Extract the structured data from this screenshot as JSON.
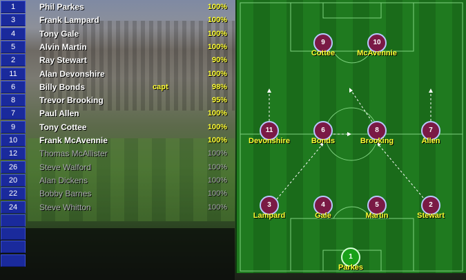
{
  "squad": [
    {
      "number": "1",
      "name": "Phil Parkes",
      "role": "",
      "fitness": "100%",
      "starter": true
    },
    {
      "number": "3",
      "name": "Frank Lampard",
      "role": "",
      "fitness": "100%",
      "starter": true
    },
    {
      "number": "4",
      "name": "Tony Gale",
      "role": "",
      "fitness": "100%",
      "starter": true
    },
    {
      "number": "5",
      "name": "Alvin Martin",
      "role": "",
      "fitness": "100%",
      "starter": true
    },
    {
      "number": "2",
      "name": "Ray Stewart",
      "role": "",
      "fitness": "90%",
      "starter": true
    },
    {
      "number": "11",
      "name": "Alan Devonshire",
      "role": "",
      "fitness": "100%",
      "starter": true
    },
    {
      "number": "6",
      "name": "Billy Bonds",
      "role": "capt",
      "fitness": "98%",
      "starter": true
    },
    {
      "number": "8",
      "name": "Trevor Brooking",
      "role": "",
      "fitness": "95%",
      "starter": true
    },
    {
      "number": "7",
      "name": "Paul Allen",
      "role": "",
      "fitness": "100%",
      "starter": true
    },
    {
      "number": "9",
      "name": "Tony Cottee",
      "role": "",
      "fitness": "100%",
      "starter": true
    },
    {
      "number": "10",
      "name": "Frank McAvennie",
      "role": "",
      "fitness": "100%",
      "starter": true
    },
    {
      "number": "12",
      "name": "Thomas McAllister",
      "role": "",
      "fitness": "100%",
      "starter": false
    },
    {
      "number": "26",
      "name": "Steve Walford",
      "role": "",
      "fitness": "100%",
      "starter": false
    },
    {
      "number": "20",
      "name": "Alan Dickens",
      "role": "",
      "fitness": "100%",
      "starter": false
    },
    {
      "number": "22",
      "name": "Bobby Barnes",
      "role": "",
      "fitness": "100%",
      "starter": false
    },
    {
      "number": "24",
      "name": "Steve Whitton",
      "role": "",
      "fitness": "100%",
      "starter": false
    }
  ],
  "pitch_players": [
    {
      "number": "9",
      "label": "Cottee"
    },
    {
      "number": "10",
      "label": "McAvennie"
    },
    {
      "number": "11",
      "label": "Devonshire"
    },
    {
      "number": "6",
      "label": "Bonds"
    },
    {
      "number": "8",
      "label": "Brooking"
    },
    {
      "number": "7",
      "label": "Allen"
    },
    {
      "number": "3",
      "label": "Lampard"
    },
    {
      "number": "4",
      "label": "Gale"
    },
    {
      "number": "5",
      "label": "Martin"
    },
    {
      "number": "2",
      "label": "Stewart"
    },
    {
      "number": "1",
      "label": "Parkes"
    }
  ],
  "colors": {
    "shirt": "#7a1a45",
    "keeper": "#19a019",
    "accent": "#ffff33",
    "list_number_bg": "#1a2a9c"
  }
}
